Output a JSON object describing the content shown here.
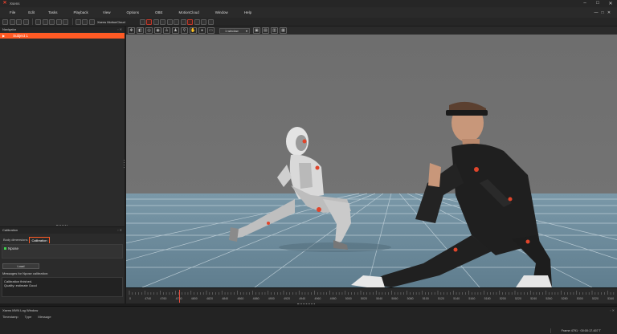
{
  "app": {
    "title": "Xsens"
  },
  "window_controls": [
    "–",
    "□",
    "✕"
  ],
  "menu": {
    "items": [
      "File",
      "Edit",
      "Tasks",
      "Playback",
      "View",
      "Options",
      "OBE",
      "MotionCloud",
      "Window",
      "Help"
    ],
    "right_controls": [
      "—",
      "□",
      "✕"
    ]
  },
  "toolbar": {
    "motioncloud_label": "Xsens MotionCloud"
  },
  "navigator": {
    "title": "Navigator",
    "controls": "▫ ✕",
    "subject_label": "Subject 1",
    "subject_arrow": "▶"
  },
  "calibration": {
    "title": "Calibration",
    "controls": "▫ ✕",
    "tabs": [
      "Body dimensions",
      "Calibration"
    ],
    "active_tab": 1,
    "calibration_name": "Npose",
    "load_button": "Load",
    "messages_label": "Messages for Npose calibration:",
    "messages": [
      "Calibration finished.",
      "Quality: estimate Good"
    ]
  },
  "viewport": {
    "layout_select": "1 window",
    "layout_chevron": "▾",
    "icons": [
      "move-icon",
      "camera-icon",
      "target-icon",
      "globe-icon",
      "person-icon",
      "figure-icon",
      "walk-icon",
      "hand-icon",
      "record-icon",
      "chat-icon"
    ],
    "icon_glyphs": [
      "✥",
      "◧",
      "◎",
      "◉",
      "♙",
      "♟",
      "⚲",
      "✋",
      "●",
      "▭"
    ],
    "layout_icons": [
      "▣",
      "▤",
      "▥",
      "▦"
    ]
  },
  "timeline": {
    "labels": [
      "0",
      "4740",
      "4760",
      "4780",
      "4800",
      "4820",
      "4840",
      "4860",
      "4880",
      "4900",
      "4920",
      "4940",
      "4960",
      "4980",
      "5000",
      "5020",
      "5040",
      "5060",
      "5080",
      "5100",
      "5120",
      "5140",
      "5160",
      "5180",
      "5200",
      "5220",
      "5240",
      "5260",
      "5280",
      "5300",
      "5320",
      "5340"
    ],
    "cursor_frame": 4785,
    "colors": {
      "cursor": "#e74c3c"
    }
  },
  "log": {
    "title": "Xsens MVN Log Window",
    "controls": "▫ ✕",
    "columns": [
      "Timestamp",
      "Type",
      "Message"
    ],
    "status_text": "Frame 4791 · 00:00:17.457 T"
  },
  "colors": {
    "accent": "#ff5a24",
    "status_ok": "#3fd44e",
    "viewport_bg": "#6c6c6c",
    "floor": "#6f8fa0"
  }
}
